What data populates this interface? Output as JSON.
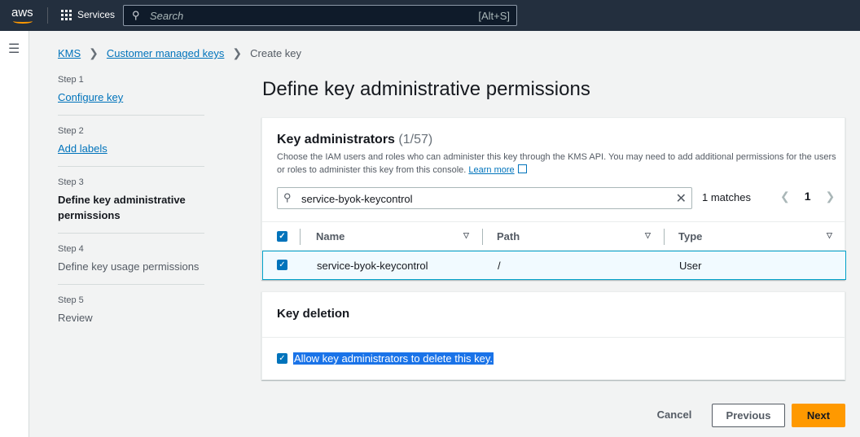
{
  "topnav": {
    "logo": "aws",
    "services": "Services",
    "search_placeholder": "Search",
    "search_shortcut": "[Alt+S]"
  },
  "breadcrumb": [
    "KMS",
    "Customer managed keys",
    "Create key"
  ],
  "steps": [
    {
      "num": "Step 1",
      "label": "Configure key",
      "state": "link"
    },
    {
      "num": "Step 2",
      "label": "Add labels",
      "state": "link"
    },
    {
      "num": "Step 3",
      "label": "Define key administrative permissions",
      "state": "current"
    },
    {
      "num": "Step 4",
      "label": "Define key usage permissions",
      "state": "disabled"
    },
    {
      "num": "Step 5",
      "label": "Review",
      "state": "disabled"
    }
  ],
  "page_title": "Define key administrative permissions",
  "admins": {
    "title": "Key administrators",
    "count": "(1/57)",
    "description": "Choose the IAM users and roles who can administer this key through the KMS API. You may need to add additional permissions for the users or roles to administer this key from this console.",
    "learn_more": "Learn more",
    "search_value": "service-byok-keycontrol",
    "matches": "1 matches",
    "page": "1",
    "columns": [
      "Name",
      "Path",
      "Type"
    ],
    "rows": [
      {
        "name": "service-byok-keycontrol",
        "path": "/",
        "type": "User",
        "checked": true
      }
    ]
  },
  "deletion": {
    "title": "Key deletion",
    "checkbox_label": "Allow key administrators to delete this key.",
    "checked": true
  },
  "footer": {
    "cancel": "Cancel",
    "previous": "Previous",
    "next": "Next"
  }
}
